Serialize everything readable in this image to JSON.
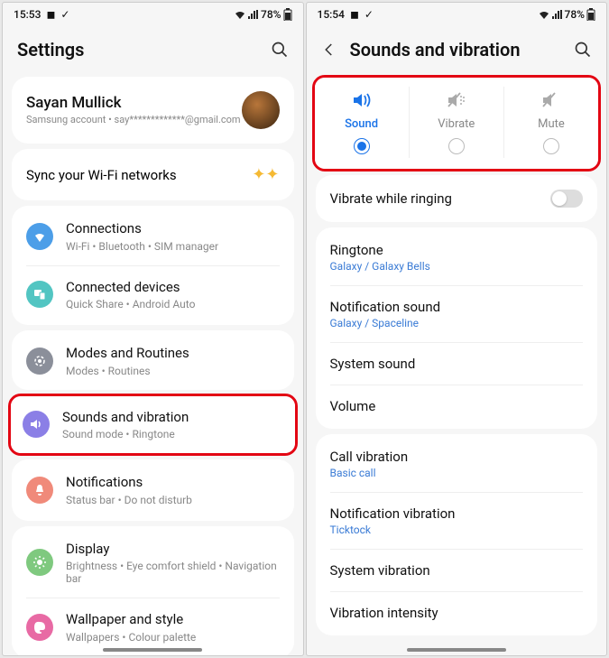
{
  "left": {
    "time": "15:53",
    "battery": "78%",
    "header": "Settings",
    "account": {
      "name": "Sayan Mullick",
      "sub": "Samsung account  •  say*************@gmail.com"
    },
    "sync": "Sync your Wi-Fi networks",
    "items": [
      {
        "title": "Connections",
        "sub": "Wi-Fi  •  Bluetooth  •  SIM manager",
        "color": "#4c9ee8"
      },
      {
        "title": "Connected devices",
        "sub": "Quick Share  •  Android Auto",
        "color": "#52c5c2"
      },
      {
        "title": "Modes and Routines",
        "sub": "Modes  •  Routines",
        "color": "#8b8f9a"
      },
      {
        "title": "Sounds and vibration",
        "sub": "Sound mode  •  Ringtone",
        "color": "#8b7fe6"
      },
      {
        "title": "Notifications",
        "sub": "Status bar  •  Do not disturb",
        "color": "#f08a7a"
      },
      {
        "title": "Display",
        "sub": "Brightness  •  Eye comfort shield  •  Navigation bar",
        "color": "#7fc97f"
      },
      {
        "title": "Wallpaper and style",
        "sub": "Wallpapers  •  Colour palette",
        "color": "#e86aa4"
      }
    ]
  },
  "right": {
    "time": "15:54",
    "battery": "78%",
    "header": "Sounds and vibration",
    "modes": [
      {
        "label": "Sound",
        "active": true
      },
      {
        "label": "Vibrate",
        "active": false
      },
      {
        "label": "Mute",
        "active": false
      }
    ],
    "vibrate_ringing": "Vibrate while ringing",
    "items1": [
      {
        "title": "Ringtone",
        "sub": "Galaxy / Galaxy Bells"
      },
      {
        "title": "Notification sound",
        "sub": "Galaxy / Spaceline"
      },
      {
        "title": "System sound",
        "sub": ""
      },
      {
        "title": "Volume",
        "sub": ""
      }
    ],
    "items2": [
      {
        "title": "Call vibration",
        "sub": "Basic call"
      },
      {
        "title": "Notification vibration",
        "sub": "Ticktock"
      },
      {
        "title": "System vibration",
        "sub": ""
      },
      {
        "title": "Vibration intensity",
        "sub": ""
      }
    ]
  }
}
